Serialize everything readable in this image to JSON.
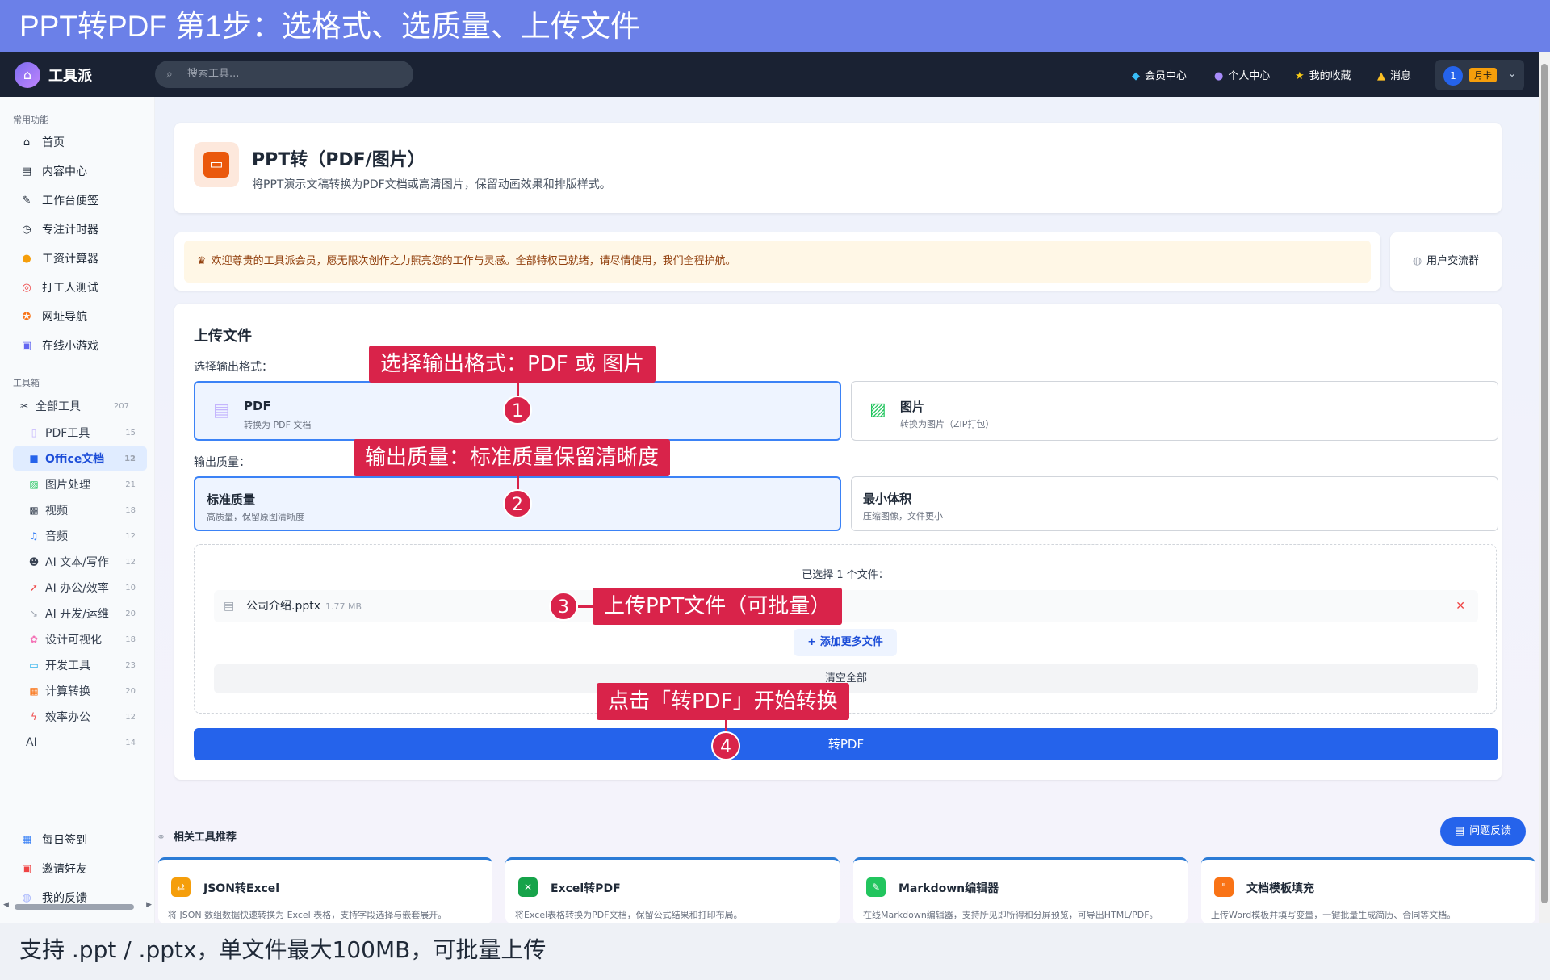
{
  "banner": {
    "text": "PPT转PDF 第1步：选格式、选质量、上传文件"
  },
  "footer_caption": {
    "text": "支持 .ppt / .pptx，单文件最大100MB，可批量上传"
  },
  "topbar": {
    "brand": "工具派",
    "search_placeholder": "搜索工具...",
    "nav": [
      {
        "label": "会员中心",
        "icon": "diamond-icon"
      },
      {
        "label": "个人中心",
        "icon": "user-icon"
      },
      {
        "label": "我的收藏",
        "icon": "star-icon"
      },
      {
        "label": "消息",
        "icon": "bell-icon"
      }
    ],
    "avatar": "1",
    "badge": "月卡"
  },
  "sidebar": {
    "section_common": "常用功能",
    "common": [
      {
        "label": "首页",
        "icon": "home-icon"
      },
      {
        "label": "内容中心",
        "icon": "news-icon"
      },
      {
        "label": "工作台便签",
        "icon": "memo-icon"
      },
      {
        "label": "专注计时器",
        "icon": "timer-icon"
      },
      {
        "label": "工资计算器",
        "icon": "money-icon"
      },
      {
        "label": "打工人测试",
        "icon": "target-icon"
      },
      {
        "label": "网址导航",
        "icon": "compass-icon"
      },
      {
        "label": "在线小游戏",
        "icon": "gamepad-icon"
      }
    ],
    "section_tools": "工具箱",
    "all_tools": {
      "label": "全部工具",
      "count": "207"
    },
    "categories": [
      {
        "label": "PDF工具",
        "count": "15"
      },
      {
        "label": "Office文档",
        "count": "12",
        "active": true
      },
      {
        "label": "图片处理",
        "count": "21"
      },
      {
        "label": "视频",
        "count": "18"
      },
      {
        "label": "音频",
        "count": "12"
      },
      {
        "label": "AI 文本/写作",
        "count": "12"
      },
      {
        "label": "AI 办公/效率",
        "count": "10"
      },
      {
        "label": "AI 开发/运维",
        "count": "20"
      },
      {
        "label": "设计可视化",
        "count": "18"
      },
      {
        "label": "开发工具",
        "count": "23"
      },
      {
        "label": "计算转换",
        "count": "20"
      },
      {
        "label": "效率办公",
        "count": "12"
      },
      {
        "label": "AI",
        "count": "14"
      }
    ],
    "bottom": [
      {
        "label": "每日签到",
        "icon": "calendar-icon"
      },
      {
        "label": "邀请好友",
        "icon": "gift-icon"
      },
      {
        "label": "我的反馈",
        "icon": "chat-icon"
      }
    ]
  },
  "header_card": {
    "title": "PPT转（PDF/图片）",
    "desc": "将PPT演示文稿转换为PDF文档或高清图片，保留动画效果和排版样式。"
  },
  "notice": {
    "text": "欢迎尊贵的工具派会员，愿无限次创作之力照亮您的工作与灵感。全部特权已就绪，请尽情使用，我们全程护航。",
    "group_button": "用户交流群"
  },
  "upload": {
    "title": "上传文件",
    "format_label": "选择输出格式：",
    "formats": [
      {
        "name": "PDF",
        "sub": "转换为 PDF 文档"
      },
      {
        "name": "图片",
        "sub": "转换为图片（ZIP打包）"
      }
    ],
    "quality_label": "输出质量：",
    "qualities": [
      {
        "name": "标准质量",
        "sub": "高质量，保留原图清晰度"
      },
      {
        "name": "最小体积",
        "sub": "压缩图像，文件更小"
      }
    ],
    "selected_count": "已选择 1 个文件：",
    "file": {
      "name": "公司介绍.pptx",
      "size": "1.77 MB"
    },
    "add_more": "+ 添加更多文件",
    "clear_all": "清空全部",
    "convert": "转PDF"
  },
  "related": {
    "title": "相关工具推荐",
    "tools": [
      {
        "name": "JSON转Excel",
        "desc": "将 JSON 数组数据快速转换为 Excel 表格，支持字段选择与嵌套展开。",
        "color": "#f59e0b"
      },
      {
        "name": "Excel转PDF",
        "desc": "将Excel表格转换为PDF文档，保留公式结果和打印布局。",
        "color": "#16a34a"
      },
      {
        "name": "Markdown编辑器",
        "desc": "在线Markdown编辑器，支持所见即所得和分屏预览，可导出HTML/PDF。",
        "color": "#22c55e"
      },
      {
        "name": "文档模板填充",
        "desc": "上传Word模板并填写变量，一键批量生成简历、合同等文档。",
        "color": "#f97316"
      }
    ]
  },
  "feedback": "问题反馈",
  "annotations": [
    {
      "num": "1",
      "text": "选择输出格式：PDF 或 图片"
    },
    {
      "num": "2",
      "text": "输出质量：标准质量保留清晰度"
    },
    {
      "num": "3",
      "text": "上传PPT文件（可批量）"
    },
    {
      "num": "4",
      "text": "点击「转PDF」开始转换"
    }
  ]
}
